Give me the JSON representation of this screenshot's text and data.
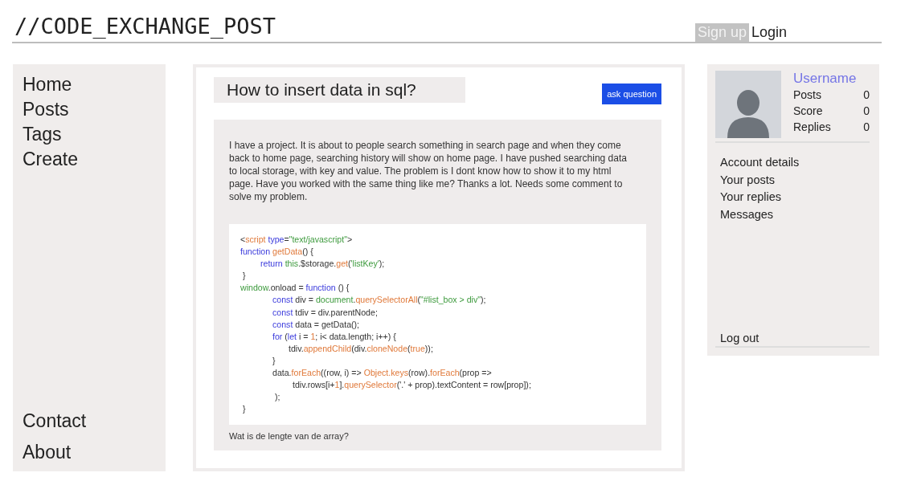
{
  "logo": "//CODE_EXCHANGE_POST",
  "auth": [
    {
      "label": "Sign up",
      "selected": true
    },
    {
      "label": "Login",
      "selected": false
    }
  ],
  "nav_top": [
    "Home",
    "Posts",
    "Tags",
    "Create"
  ],
  "nav_bottom": [
    "Contact",
    "About"
  ],
  "question": {
    "title": "How to insert data in sql?",
    "ask_button": "ask question",
    "body": "I have a project. It is about to people search something in search page and when they come back to home page, searching history will show on home page. I have pushed searching data to local storage, with key and value. The problem is I dont know how to show it to my html page. Have you worked with the same thing like me? Thanks a lot. Needs some comment to solve my problem.",
    "code": [
      {
        "kind": "flush",
        "tokens": [
          {
            "kind": "plain",
            "text": "<"
          },
          {
            "kind": "func",
            "text": "script"
          },
          {
            "kind": "keyword",
            "text": " type"
          },
          {
            "kind": "plain",
            "text": "="
          },
          {
            "kind": "string",
            "text": "\"text/javascript\""
          },
          {
            "kind": "plain",
            "text": ">"
          }
        ]
      },
      {
        "kind": "flush",
        "tokens": [
          {
            "kind": "keyword",
            "text": "function"
          },
          {
            "kind": "func",
            "text": " getData"
          },
          {
            "kind": "plain",
            "text": "() {"
          }
        ]
      },
      {
        "kind": "step",
        "tokens": [
          {
            "kind": "keyword",
            "text": "return"
          },
          {
            "kind": "string",
            "text": " this"
          },
          {
            "kind": "plain",
            "text": ".$storage."
          },
          {
            "kind": "func",
            "text": "get"
          },
          {
            "kind": "plain",
            "text": "("
          },
          {
            "kind": "string",
            "text": "'listKey'"
          },
          {
            "kind": "plain",
            "text": ");"
          }
        ]
      },
      {
        "kind": "brace",
        "tokens": [
          {
            "kind": "plain",
            "text": "}"
          }
        ]
      },
      {
        "kind": "flush",
        "tokens": [
          {
            "kind": "string",
            "text": "window"
          },
          {
            "kind": "plain",
            "text": ".onload = "
          },
          {
            "kind": "keyword",
            "text": "function"
          },
          {
            "kind": "plain",
            "text": " () {"
          }
        ]
      },
      {
        "kind": "block",
        "tokens": [
          {
            "kind": "keyword",
            "text": "const"
          },
          {
            "kind": "plain",
            "text": " div = "
          },
          {
            "kind": "string",
            "text": "document"
          },
          {
            "kind": "plain",
            "text": "."
          },
          {
            "kind": "func",
            "text": "querySelectorAll"
          },
          {
            "kind": "plain",
            "text": "("
          },
          {
            "kind": "string",
            "text": "\"#list_box > div\""
          },
          {
            "kind": "plain",
            "text": ");"
          }
        ]
      },
      {
        "kind": "block",
        "tokens": [
          {
            "kind": "keyword",
            "text": "const"
          },
          {
            "kind": "plain",
            "text": " tdiv = div.parentNode;"
          }
        ]
      },
      {
        "kind": "block",
        "tokens": [
          {
            "kind": "keyword",
            "text": "const"
          },
          {
            "kind": "plain",
            "text": " data = getData();"
          }
        ]
      },
      {
        "kind": "block",
        "tokens": [
          {
            "kind": "keyword",
            "text": "for"
          },
          {
            "kind": "plain",
            "text": " ("
          },
          {
            "kind": "keyword",
            "text": "let"
          },
          {
            "kind": "plain",
            "text": " i = "
          },
          {
            "kind": "func",
            "text": "1"
          },
          {
            "kind": "plain",
            "text": "; i< data.length; i++) {"
          }
        ]
      },
      {
        "kind": "inner",
        "tokens": [
          {
            "kind": "plain",
            "text": "tdiv."
          },
          {
            "kind": "func",
            "text": "appendChild"
          },
          {
            "kind": "plain",
            "text": "(div."
          },
          {
            "kind": "func",
            "text": "cloneNode"
          },
          {
            "kind": "plain",
            "text": "("
          },
          {
            "kind": "func",
            "text": "true"
          },
          {
            "kind": "plain",
            "text": "));"
          }
        ]
      },
      {
        "kind": "block",
        "tokens": [
          {
            "kind": "plain",
            "text": "}"
          }
        ]
      },
      {
        "kind": "block",
        "tokens": [
          {
            "kind": "plain",
            "text": "data."
          },
          {
            "kind": "func",
            "text": "forEach"
          },
          {
            "kind": "plain",
            "text": "((row, i) => "
          },
          {
            "kind": "func",
            "text": "Object.keys"
          },
          {
            "kind": "plain",
            "text": "(row)."
          },
          {
            "kind": "func",
            "text": "forEach"
          },
          {
            "kind": "plain",
            "text": "(prop =>"
          }
        ]
      },
      {
        "kind": "wrap",
        "tokens": [
          {
            "kind": "plain",
            "text": "tdiv.rows[i+"
          },
          {
            "kind": "func",
            "text": "1"
          },
          {
            "kind": "plain",
            "text": "]."
          },
          {
            "kind": "func",
            "text": "querySelector"
          },
          {
            "kind": "plain",
            "text": "('.' + prop).textContent = row[prop]);"
          }
        ]
      },
      {
        "kind": "paren",
        "tokens": [
          {
            "kind": "plain",
            "text": ");"
          }
        ]
      },
      {
        "kind": "brace",
        "tokens": [
          {
            "kind": "plain",
            "text": "}"
          }
        ]
      }
    ],
    "footer_question": "Wat is de lengte van de array?"
  },
  "profile": {
    "username": "Username",
    "stats": [
      {
        "label": "Posts",
        "value": "0"
      },
      {
        "label": "Score",
        "value": "0"
      },
      {
        "label": "Replies",
        "value": "0"
      }
    ],
    "links": [
      "Account details",
      "Your posts",
      "Your replies",
      "Messages"
    ],
    "logout": "Log out"
  }
}
